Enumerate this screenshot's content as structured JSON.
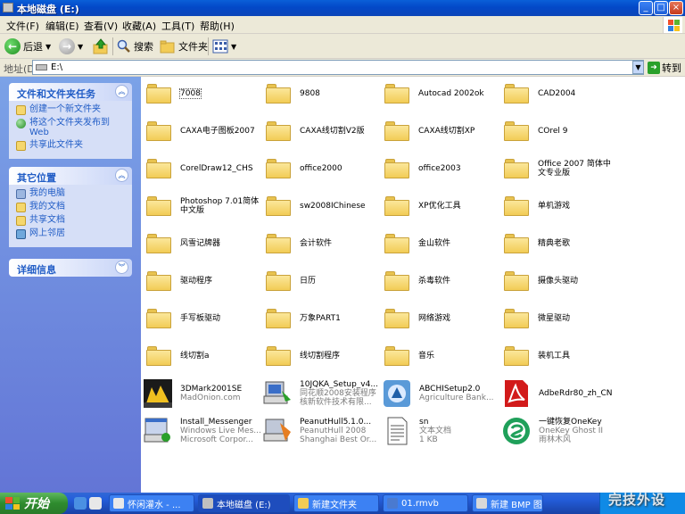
{
  "window": {
    "title": "本地磁盘 (E:)",
    "buttons": {
      "min": "_",
      "max": "□",
      "close": "×"
    }
  },
  "menu": [
    "文件(F)",
    "编辑(E)",
    "查看(V)",
    "收藏(A)",
    "工具(T)",
    "帮助(H)"
  ],
  "toolbar": {
    "back": "后退",
    "search": "搜索",
    "folders": "文件夹"
  },
  "address": {
    "label": "地址(D)",
    "value": "E:\\",
    "go": "转到"
  },
  "left_pane": {
    "tasks": {
      "title": "文件和文件夹任务",
      "items": [
        {
          "label": "创建一个新文件夹",
          "icon": "new-folder-icon"
        },
        {
          "label": "将这个文件夹发布到",
          "sub": "Web",
          "icon": "publish-web-icon"
        },
        {
          "label": "共享此文件夹",
          "icon": "share-folder-icon"
        }
      ]
    },
    "places": {
      "title": "其它位置",
      "items": [
        {
          "label": "我的电脑",
          "icon": "my-computer-icon"
        },
        {
          "label": "我的文档",
          "icon": "my-documents-icon"
        },
        {
          "label": "共享文档",
          "icon": "shared-documents-icon"
        },
        {
          "label": "网上邻居",
          "icon": "network-icon"
        }
      ]
    },
    "details": {
      "title": "详细信息"
    }
  },
  "folders": [
    [
      "7008",
      "9808",
      "Autocad 2002ok",
      "CAD2004"
    ],
    [
      "CAXA电子图板2007",
      "CAXA线切割V2版",
      "CAXA线切割XP",
      "COrel  9"
    ],
    [
      "CorelDraw12_CHS",
      "office2000",
      "office2003",
      "Office 2007 简体中文专业版"
    ],
    [
      "Photoshop 7.01简体中文版",
      "sw2008IChinese",
      "XP优化工具",
      "单机游戏"
    ],
    [
      "风雪记牌器",
      "会计软件",
      "金山软件",
      "精典老歌"
    ],
    [
      "驱动程序",
      "日历",
      "杀毒软件",
      "摄像头驱动"
    ],
    [
      "手写板驱动",
      "万象PART1",
      "网络游戏",
      "微星驱动"
    ],
    [
      "线切割a",
      "线切割程序",
      "音乐",
      "装机工具"
    ]
  ],
  "files": [
    {
      "name": "3DMark2001SE",
      "sub1": "MadOnion.com",
      "sub2": "",
      "icon": "3dmark-icon"
    },
    {
      "name": "10JQKA_Setup_v4...",
      "sub1": "同花顺2008安装程序",
      "sub2": "核新软件技术有限...",
      "icon": "installer-icon"
    },
    {
      "name": "ABCHISetup2.0",
      "sub1": "Agriculture Bank...",
      "sub2": "",
      "icon": "abc-bank-icon"
    },
    {
      "name": "AdbeRdr80_zh_CN",
      "sub1": "",
      "sub2": "",
      "icon": "adobe-reader-icon"
    },
    {
      "name": "Install_Messenger",
      "sub1": "Windows Live Mes...",
      "sub2": "Microsoft Corpor...",
      "icon": "messenger-installer-icon"
    },
    {
      "name": "PeanutHull5.1.0...",
      "sub1": "PeanutHull 2008",
      "sub2": "Shanghai Best Or...",
      "icon": "peanuthull-icon"
    },
    {
      "name": "sn",
      "sub1": "文本文档",
      "sub2": "1 KB",
      "icon": "text-document-icon"
    },
    {
      "name": "一键恢复OneKey",
      "sub1": "OneKey Ghost II",
      "sub2": "雨林木风",
      "icon": "onekey-ghost-icon"
    }
  ],
  "taskbar": {
    "start": "开始",
    "tasks": [
      {
        "label": "怀闲灌水 - ...",
        "active": false
      },
      {
        "label": "本地磁盘 (E:)",
        "active": true
      },
      {
        "label": "新建文件夹",
        "active": false
      },
      {
        "label": "01.rmvb",
        "active": false
      },
      {
        "label": "新建 BMP 图...",
        "active": false
      }
    ]
  },
  "watermark": "完技外设"
}
